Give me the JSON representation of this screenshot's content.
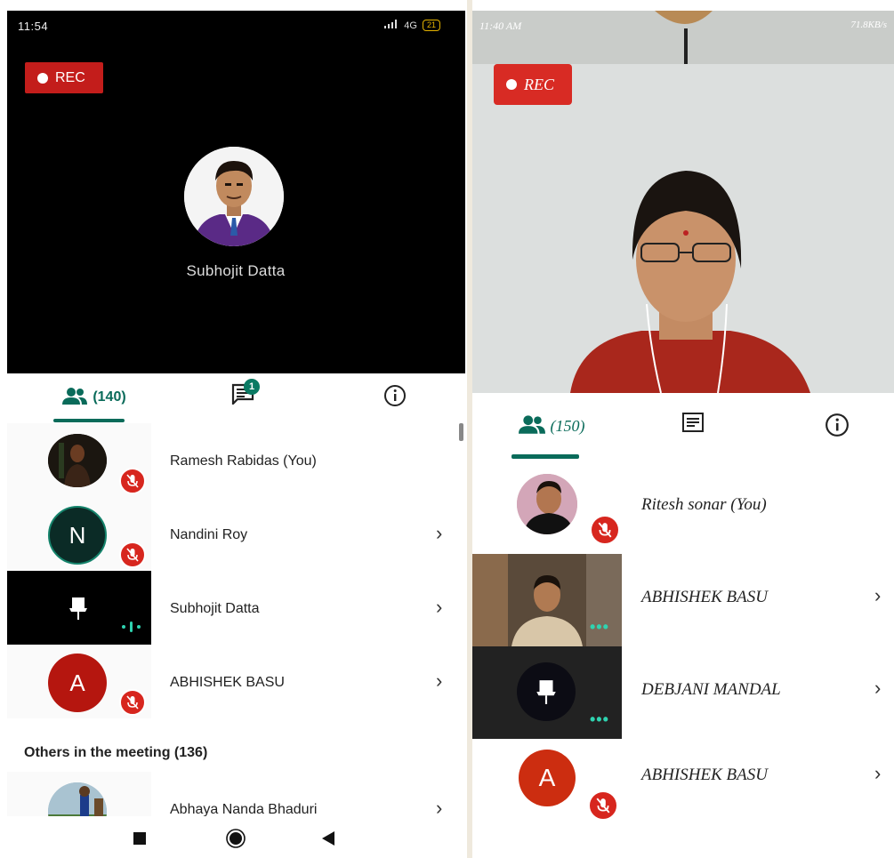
{
  "left": {
    "status_time": "11:54",
    "status_network": "4G",
    "status_battery": "21",
    "rec_label": "REC",
    "host_name": "Subhojit Datta",
    "tabs": {
      "people_count": "(140)",
      "chat_badge": "1"
    },
    "participants": [
      {
        "name": "Ramesh Rabidas (You)",
        "muted": true
      },
      {
        "name": "Nandini Roy",
        "initial": "N",
        "muted": true
      },
      {
        "name": "Subhojit Datta",
        "speaking": true
      },
      {
        "name": "ABHISHEK BASU",
        "initial": "A",
        "muted": true
      }
    ],
    "others_title": "Others in the meeting (136)",
    "others": [
      {
        "name": "Abhaya Nanda Bhaduri"
      }
    ]
  },
  "right": {
    "status_time": "11:40 AM",
    "status_speed": "71.8KB/s",
    "rec_label": "REC",
    "tabs": {
      "people_count": "(150)"
    },
    "participants": [
      {
        "name": "Ritesh sonar (You)",
        "muted": true
      },
      {
        "name": "ABHISHEK BASU"
      },
      {
        "name": "DEBJANI MANDAL"
      },
      {
        "name": "ABHISHEK BASU",
        "initial": "A",
        "muted": true
      }
    ]
  },
  "colors": {
    "accent": "#0a6b5a",
    "rec": "#c31d1b",
    "mute": "#d7261e",
    "avatar_red": "#b5160f",
    "avatar_dark": "#0b2b26"
  }
}
